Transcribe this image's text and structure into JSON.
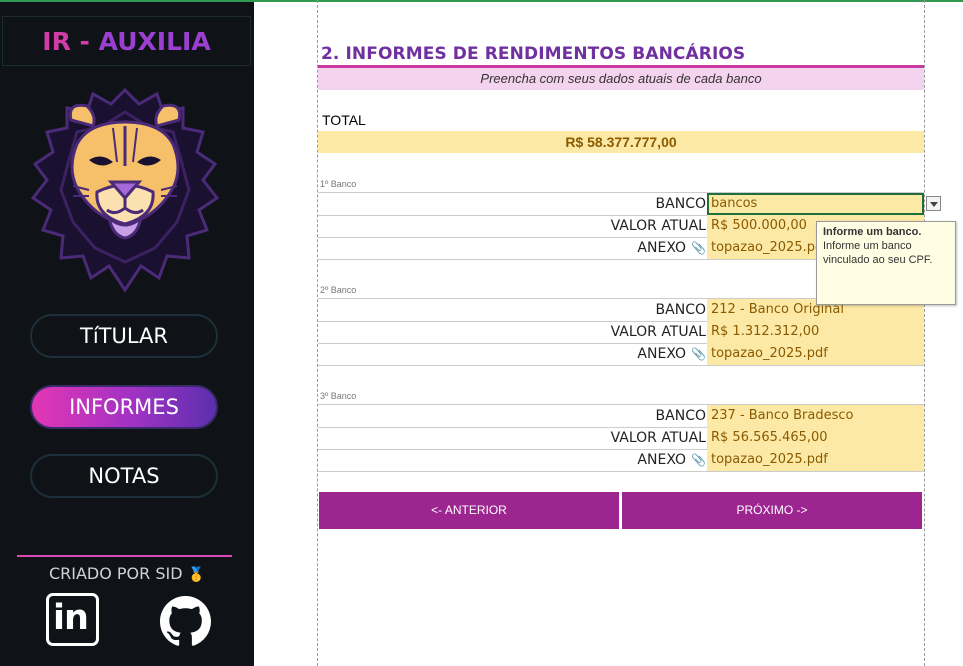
{
  "brand": {
    "part1": "IR - ",
    "part2": "AUXILIA"
  },
  "nav": {
    "titular": "TíTULAR",
    "informes": "INFORMES",
    "notas": "NOTAS"
  },
  "credit": {
    "text": "CRIADO POR SID",
    "medal": "🥇"
  },
  "social": {
    "linkedin": "in"
  },
  "section": {
    "title": "2. INFORMES DE RENDIMENTOS BANCÁRIOS",
    "subtitle": "Preencha com seus dados atuais de cada banco"
  },
  "total": {
    "label": "TOTAL",
    "value": "R$ 58.377.777,00"
  },
  "field_labels": {
    "bank": "BANCO",
    "value": "VALOR ATUAL",
    "attachment": "ANEXO"
  },
  "banks": [
    {
      "caption": "1º Banco",
      "bank": "bancos",
      "value": "R$ 500.000,00",
      "attachment": "topazao_2025.pdf"
    },
    {
      "caption": "2º Banco",
      "bank": "212 - Banco Original",
      "value": "R$ 1.312.312,00",
      "attachment": "topazao_2025.pdf"
    },
    {
      "caption": "3º Banco",
      "bank": "237 - Banco Bradesco",
      "value": "R$ 56.565.465,00",
      "attachment": "topazao_2025.pdf"
    }
  ],
  "tooltip": {
    "title": "Informe um banco.",
    "body": "Informe um banco vinculado ao seu CPF."
  },
  "buttons": {
    "prev": "<- ANTERIOR",
    "next": "PRÓXIMO ->"
  },
  "colors": {
    "accent": "#9c2590",
    "title": "#7030a0",
    "highlight": "#fde9a6",
    "sidebar": "#0f1317"
  }
}
